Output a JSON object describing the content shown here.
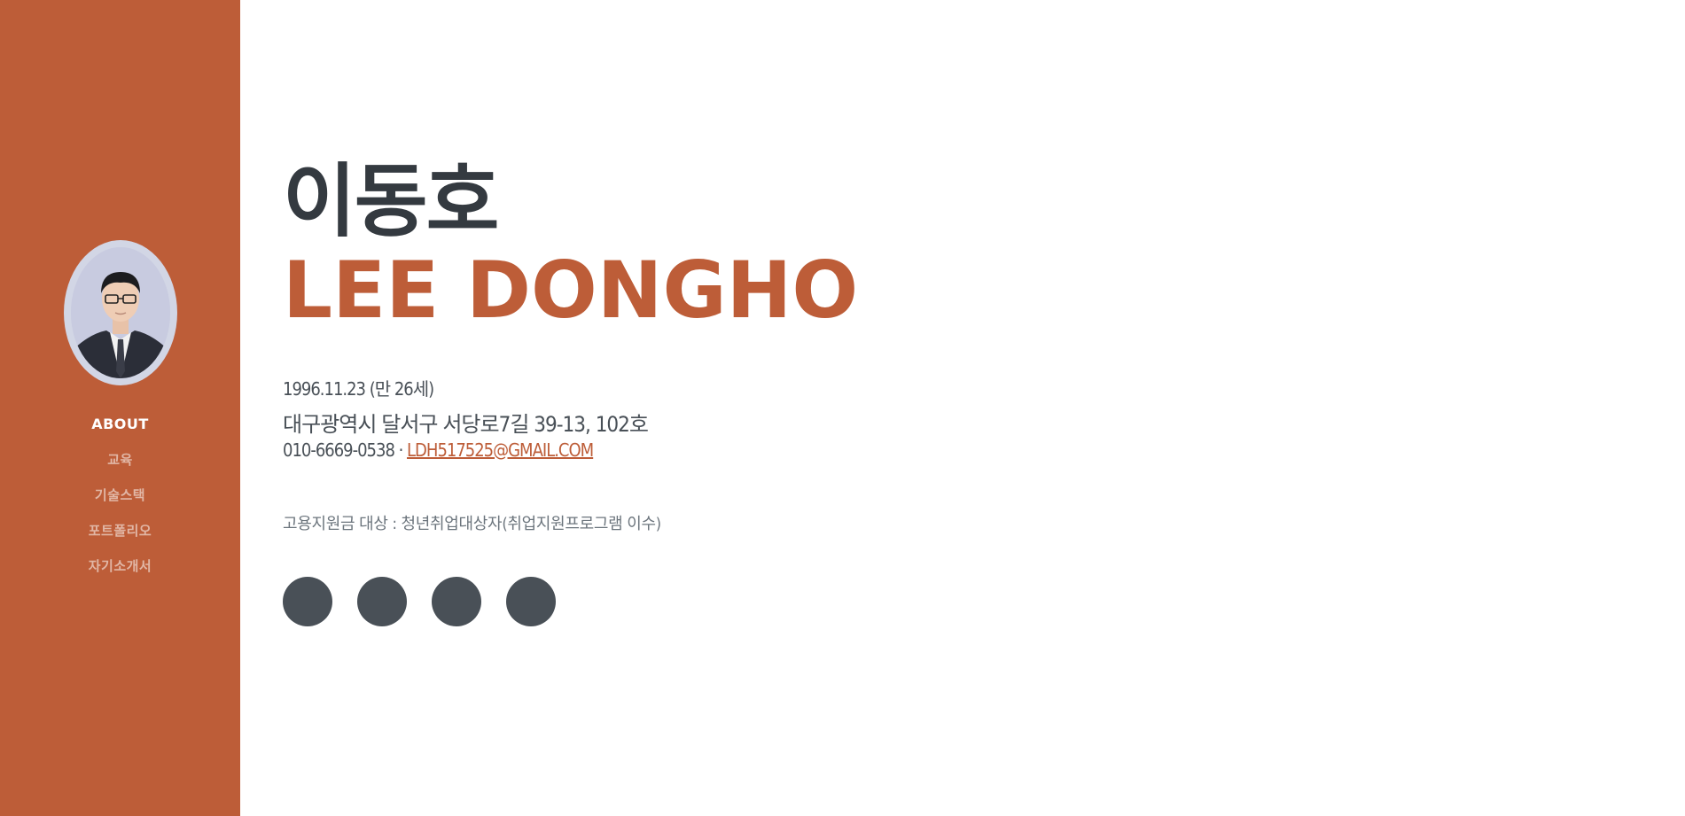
{
  "sidebar": {
    "nav": [
      {
        "label": "ABOUT"
      },
      {
        "label": "교육"
      },
      {
        "label": "기술스택"
      },
      {
        "label": "포트폴리오"
      },
      {
        "label": "자기소개서"
      }
    ]
  },
  "main": {
    "name_ko": "이동호",
    "name_en": "LEE DONGHO",
    "birth": "1996.11.23 (만 26세)",
    "address": "대구광역시 달서구 서당로7길 39-13, 102호",
    "phone": "010-6669-0538 · ",
    "email": "LDH517525@GMAIL.COM",
    "subsidy": "고용지원금 대상 : 청년취업대상자(취업지원프로그램 이수)"
  },
  "social": [
    "github-icon",
    "blog-icon",
    "instagram-icon",
    "mail-icon"
  ],
  "colors": {
    "primary": "#bd5d38",
    "dark": "#343a40",
    "icon_bg": "#495057"
  }
}
